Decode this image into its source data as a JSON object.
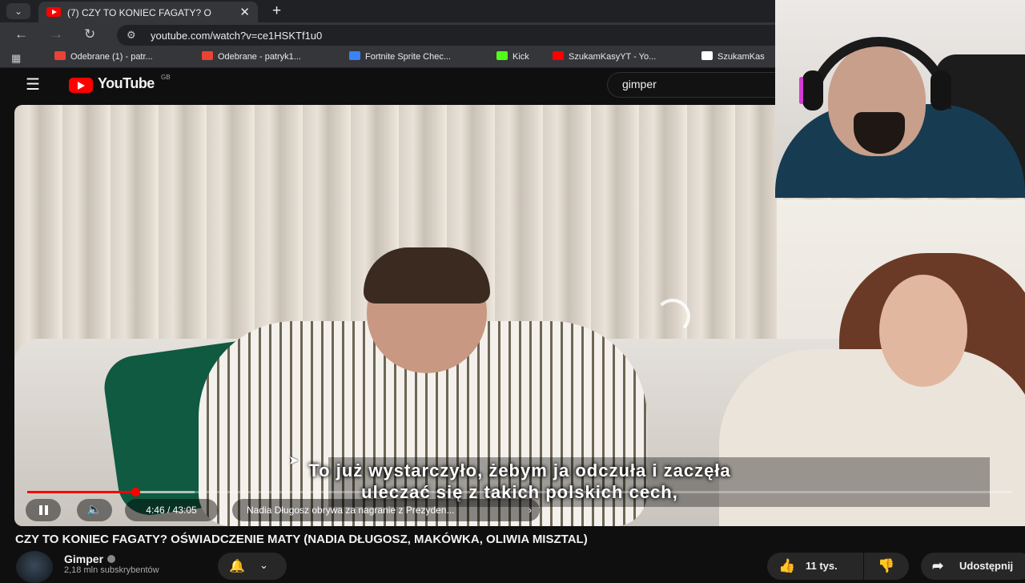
{
  "browser": {
    "tab_title": "(7) CZY TO KONIEC FAGATY? O",
    "address": "youtube.com/watch?v=ce1HSKTf1u0",
    "bookmarks": [
      {
        "label": "Odebrane (1) - patr...",
        "icon": "gmail-icon",
        "color": "#ea4335"
      },
      {
        "label": "Odebrane - patryk1...",
        "icon": "gmail-icon",
        "color": "#ea4335"
      },
      {
        "label": "Fortnite Sprite Chec...",
        "icon": "fortnite-icon",
        "color": "#3b82f6"
      },
      {
        "label": "Kick",
        "icon": "kick-icon",
        "color": "#53fc18"
      },
      {
        "label": "SzukamKasyYT - Yo...",
        "icon": "youtube-icon",
        "color": "#ff0000"
      },
      {
        "label": "SzukamKas",
        "icon": "tiktok-icon",
        "color": "#ffffff"
      }
    ]
  },
  "youtube": {
    "logo_text": "YouTube",
    "region": "GB",
    "search_value": "gimper"
  },
  "player": {
    "subtitle_line1": "To już wystarczyło, żebym ja odczuła i zaczęła",
    "subtitle_line2": "uleczać się z takich polskich cech,",
    "current_time": "4:46 / 43:05",
    "chapter": "Nadia Długosz obrywa za nagranie z Prezyden...",
    "chapter_arrow": "›",
    "progress_fraction": 0.11,
    "loaded_fraction": 0.17
  },
  "video": {
    "title": "CZY TO KONIEC FAGATY? OŚWIADCZENIE MATY (NADIA DŁUGOSZ, MAKÓWKA, OLIWIA MISZTAL)",
    "channel": "Gimper",
    "subscribers": "2,18 mln subskrybentów",
    "likes": "11 tys.",
    "share_label": "Udostępnij"
  },
  "colors": {
    "accent": "#ff0000",
    "background": "#0f0f0f"
  }
}
